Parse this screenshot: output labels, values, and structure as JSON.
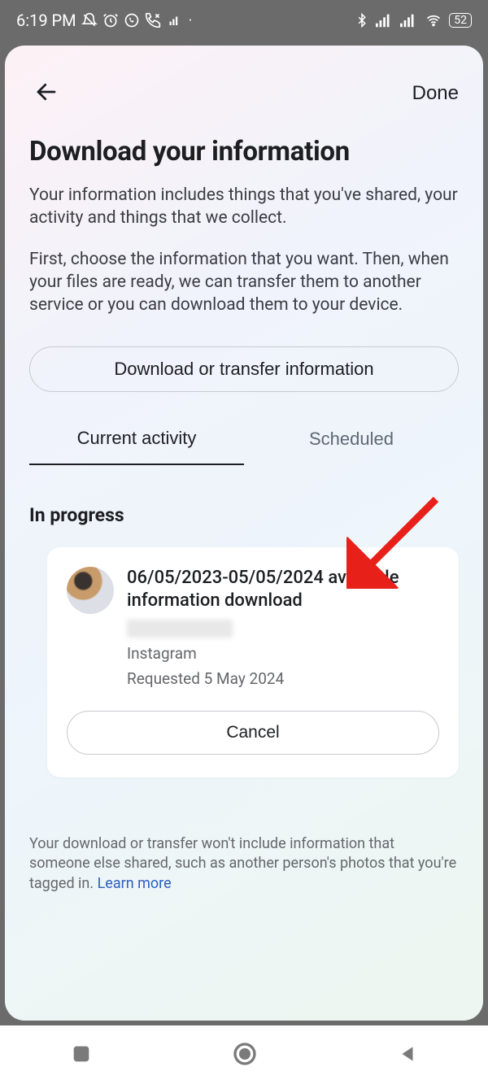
{
  "status": {
    "time": "6:19 PM",
    "battery": "52"
  },
  "header": {
    "done_label": "Done"
  },
  "page": {
    "title": "Download your information",
    "desc1": "Your information includes things that you've shared, your activity and things that we collect.",
    "desc2": "First, choose the information that you want. Then, when your files are ready, we can transfer them to another service or you can download them to your device.",
    "primary_button_label": "Download or transfer information"
  },
  "tabs": {
    "current": "Current activity",
    "scheduled": "Scheduled"
  },
  "section": {
    "in_progress": "In progress"
  },
  "activity": {
    "title": "06/05/2023-05/05/2024 available information download",
    "platform": "Instagram",
    "requested": "Requested 5 May 2024",
    "cancel_label": "Cancel"
  },
  "footer": {
    "note": "Your download or transfer won't include information that someone else shared, such as another person's photos that you're tagged in. ",
    "learn_more": "Learn more"
  }
}
